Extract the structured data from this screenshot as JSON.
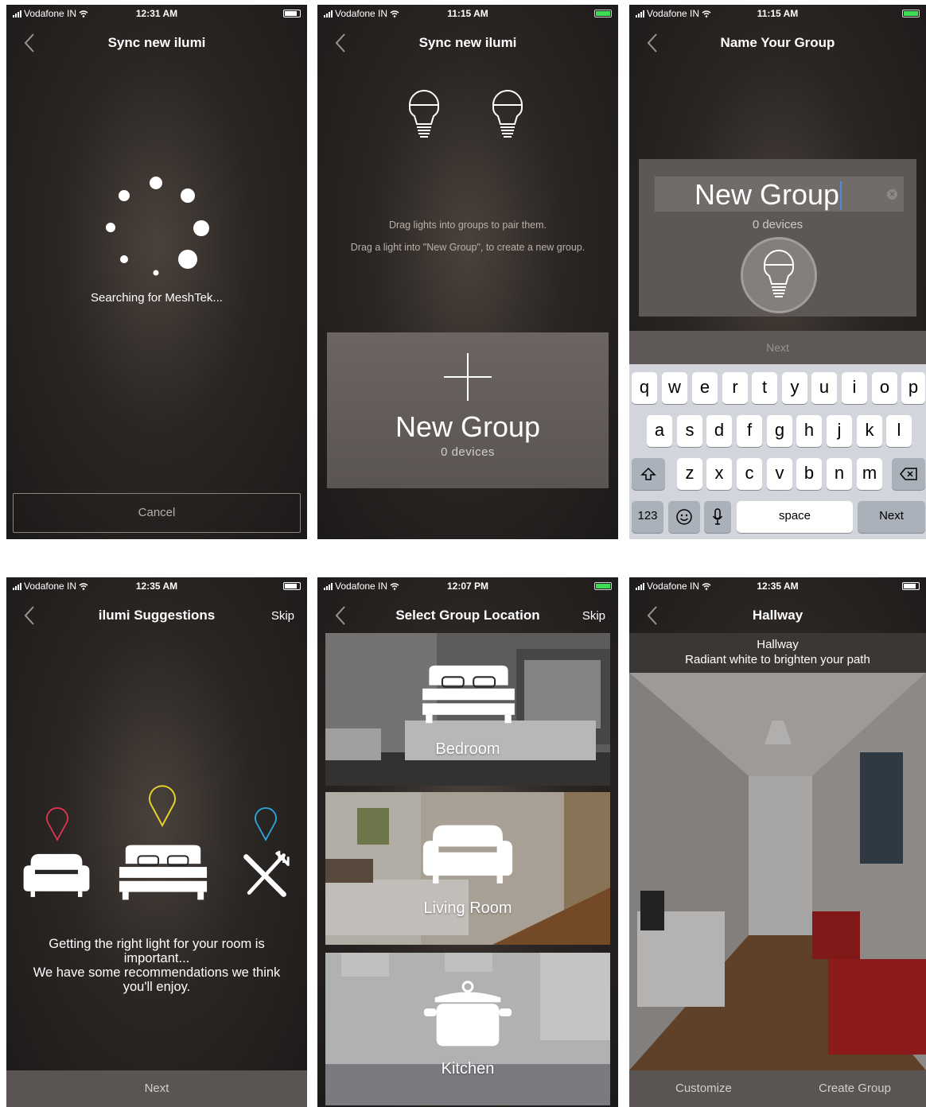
{
  "screens": [
    {
      "status": {
        "carrier": "Vodafone IN",
        "time": "12:31 AM"
      },
      "nav": {
        "title": "Sync new ilumi"
      },
      "body": {
        "searching": "Searching for MeshTek..."
      },
      "cancel_label": "Cancel"
    },
    {
      "status": {
        "carrier": "Vodafone IN",
        "time": "11:15 AM"
      },
      "nav": {
        "title": "Sync new ilumi"
      },
      "hint_1": "Drag lights into groups to pair them.",
      "hint_2": "Drag a light into \"New Group\", to create a new group.",
      "new_group": {
        "title": "New Group",
        "count": "0 devices"
      }
    },
    {
      "status": {
        "carrier": "Vodafone IN",
        "time": "11:15 AM"
      },
      "nav": {
        "title": "Name Your Group"
      },
      "group_name_value": "New Group",
      "group_count": "0 devices",
      "next_label": "Next",
      "keyboard": {
        "row1": [
          "q",
          "w",
          "e",
          "r",
          "t",
          "y",
          "u",
          "i",
          "o",
          "p"
        ],
        "row2": [
          "a",
          "s",
          "d",
          "f",
          "g",
          "h",
          "j",
          "k",
          "l"
        ],
        "row3": [
          "z",
          "x",
          "c",
          "v",
          "b",
          "n",
          "m"
        ],
        "numbers": "123",
        "space": "space",
        "return": "Next"
      }
    },
    {
      "status": {
        "carrier": "Vodafone IN",
        "time": "12:35 AM"
      },
      "nav": {
        "title": "ilumi Suggestions",
        "skip": "Skip"
      },
      "text_1": "Getting the right light for your room is important...",
      "text_2": "We have some recommendations we think you'll enjoy.",
      "next_label": "Next",
      "pin_colors": [
        "#e0344f",
        "#e6d229",
        "#2fa7e0"
      ]
    },
    {
      "status": {
        "carrier": "Vodafone IN",
        "time": "12:07 PM"
      },
      "nav": {
        "title": "Select Group Location",
        "skip": "Skip"
      },
      "locations": [
        "Bedroom",
        "Living Room",
        "Kitchen"
      ]
    },
    {
      "status": {
        "carrier": "Vodafone IN",
        "time": "12:35 AM"
      },
      "nav": {
        "title": "Hallway"
      },
      "header": {
        "name": "Hallway",
        "desc": "Radiant white to brighten your path"
      },
      "customize_label": "Customize",
      "create_label": "Create Group"
    }
  ]
}
